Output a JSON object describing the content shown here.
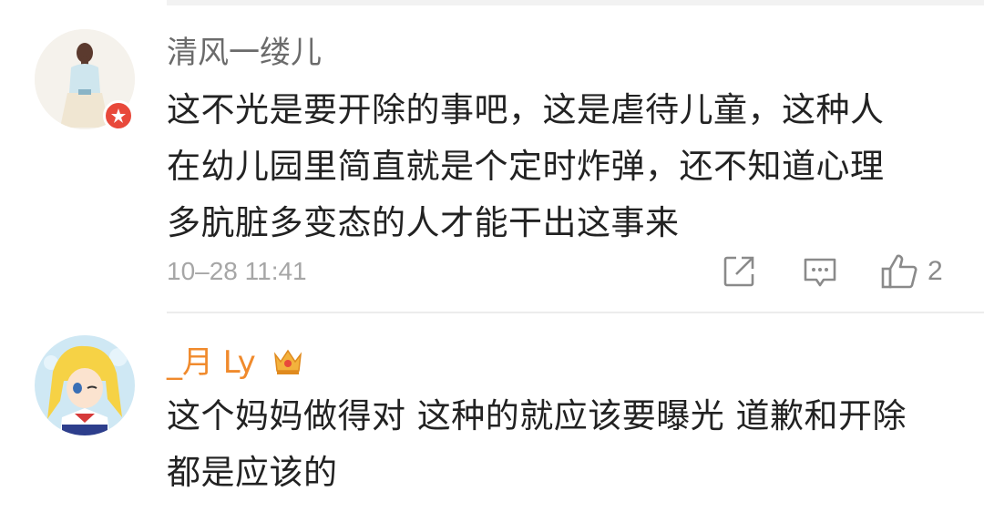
{
  "comments": [
    {
      "username": "清风一缕儿",
      "lines": [
        "这不光是要开除的事吧，这是虐待儿童，这种人",
        "在幼儿园里简直就是个定时炸弹，还不知道心理",
        "多肮脏多变态的人才能干出这事来"
      ],
      "timestamp": "10–28 11:41",
      "like_count": "2"
    },
    {
      "username": "_月 Ly",
      "lines": [
        "这个妈妈做得对 这种的就应该要曝光 道歉和开除",
        "都是应该的"
      ]
    }
  ],
  "colors": {
    "username_gray": "#6b6b6b",
    "username_orange": "#f08a2c",
    "text": "#222222",
    "muted": "#a6a6a6",
    "badge": "#e8493b"
  },
  "icons": [
    "share-icon",
    "comment-icon",
    "like-icon",
    "verified-badge-icon",
    "crown-badge-icon"
  ]
}
